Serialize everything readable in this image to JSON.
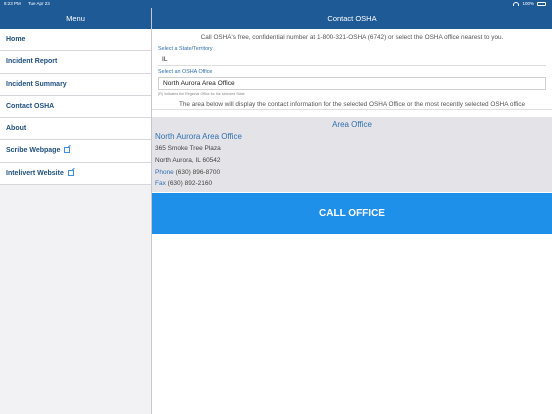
{
  "status_bar": {
    "time": "8:23 PM",
    "date": "Tue Apr 23",
    "battery": "100%"
  },
  "sidebar": {
    "title": "Menu",
    "items": [
      {
        "label": "Home",
        "external": false
      },
      {
        "label": "Incident Report",
        "external": false
      },
      {
        "label": "Incident Summary",
        "external": false
      },
      {
        "label": "Contact OSHA",
        "external": false
      },
      {
        "label": "About",
        "external": false
      },
      {
        "label": "Scribe Webpage",
        "external": true
      },
      {
        "label": "Intelivert Website",
        "external": true
      }
    ]
  },
  "main": {
    "title": "Contact OSHA",
    "intro": "Call OSHA's free, confidential number at 1-800-321-OSHA (6742) or select the OSHA office nearest to you.",
    "state_label": "Select a State/Territory",
    "state_value": "IL",
    "office_label": "Select an OSHA Office",
    "office_value": "North Aurora Area Office",
    "note": "(R) indicates the Regional Office for the selected State",
    "info": "The area below will display the contact information for the selected OSHA Office or the most recently selected OSHA office",
    "area_header": "Area Office",
    "office": {
      "name": "North Aurora Area Office",
      "street": "365 Smoke Tree Plaza",
      "city": "North Aurora, IL 60542",
      "phone_label": "Phone",
      "phone": "(630) 896-8700",
      "fax_label": "Fax",
      "fax": "(630) 892-2160"
    },
    "call_button": "CALL OFFICE"
  },
  "colors": {
    "nav": "#1e5a96",
    "accent": "#2f6fb0",
    "button": "#1e90ea"
  }
}
